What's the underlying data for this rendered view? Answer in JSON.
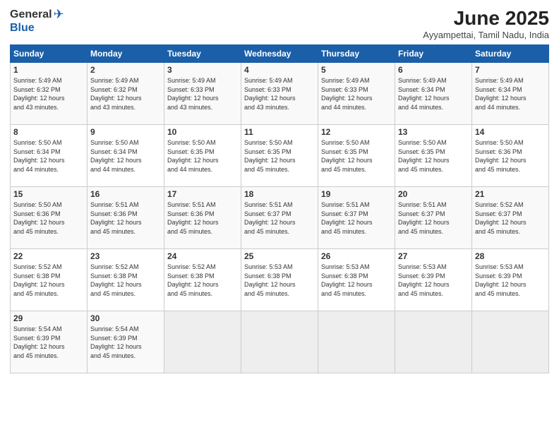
{
  "header": {
    "logo_general": "General",
    "logo_blue": "Blue",
    "title": "June 2025",
    "subtitle": "Ayyampettai, Tamil Nadu, India"
  },
  "days_of_week": [
    "Sunday",
    "Monday",
    "Tuesday",
    "Wednesday",
    "Thursday",
    "Friday",
    "Saturday"
  ],
  "weeks": [
    [
      {
        "num": "1",
        "info": "Sunrise: 5:49 AM\nSunset: 6:32 PM\nDaylight: 12 hours\nand 43 minutes."
      },
      {
        "num": "2",
        "info": "Sunrise: 5:49 AM\nSunset: 6:32 PM\nDaylight: 12 hours\nand 43 minutes."
      },
      {
        "num": "3",
        "info": "Sunrise: 5:49 AM\nSunset: 6:33 PM\nDaylight: 12 hours\nand 43 minutes."
      },
      {
        "num": "4",
        "info": "Sunrise: 5:49 AM\nSunset: 6:33 PM\nDaylight: 12 hours\nand 43 minutes."
      },
      {
        "num": "5",
        "info": "Sunrise: 5:49 AM\nSunset: 6:33 PM\nDaylight: 12 hours\nand 44 minutes."
      },
      {
        "num": "6",
        "info": "Sunrise: 5:49 AM\nSunset: 6:34 PM\nDaylight: 12 hours\nand 44 minutes."
      },
      {
        "num": "7",
        "info": "Sunrise: 5:49 AM\nSunset: 6:34 PM\nDaylight: 12 hours\nand 44 minutes."
      }
    ],
    [
      {
        "num": "8",
        "info": "Sunrise: 5:50 AM\nSunset: 6:34 PM\nDaylight: 12 hours\nand 44 minutes."
      },
      {
        "num": "9",
        "info": "Sunrise: 5:50 AM\nSunset: 6:34 PM\nDaylight: 12 hours\nand 44 minutes."
      },
      {
        "num": "10",
        "info": "Sunrise: 5:50 AM\nSunset: 6:35 PM\nDaylight: 12 hours\nand 44 minutes."
      },
      {
        "num": "11",
        "info": "Sunrise: 5:50 AM\nSunset: 6:35 PM\nDaylight: 12 hours\nand 45 minutes."
      },
      {
        "num": "12",
        "info": "Sunrise: 5:50 AM\nSunset: 6:35 PM\nDaylight: 12 hours\nand 45 minutes."
      },
      {
        "num": "13",
        "info": "Sunrise: 5:50 AM\nSunset: 6:35 PM\nDaylight: 12 hours\nand 45 minutes."
      },
      {
        "num": "14",
        "info": "Sunrise: 5:50 AM\nSunset: 6:36 PM\nDaylight: 12 hours\nand 45 minutes."
      }
    ],
    [
      {
        "num": "15",
        "info": "Sunrise: 5:50 AM\nSunset: 6:36 PM\nDaylight: 12 hours\nand 45 minutes."
      },
      {
        "num": "16",
        "info": "Sunrise: 5:51 AM\nSunset: 6:36 PM\nDaylight: 12 hours\nand 45 minutes."
      },
      {
        "num": "17",
        "info": "Sunrise: 5:51 AM\nSunset: 6:36 PM\nDaylight: 12 hours\nand 45 minutes."
      },
      {
        "num": "18",
        "info": "Sunrise: 5:51 AM\nSunset: 6:37 PM\nDaylight: 12 hours\nand 45 minutes."
      },
      {
        "num": "19",
        "info": "Sunrise: 5:51 AM\nSunset: 6:37 PM\nDaylight: 12 hours\nand 45 minutes."
      },
      {
        "num": "20",
        "info": "Sunrise: 5:51 AM\nSunset: 6:37 PM\nDaylight: 12 hours\nand 45 minutes."
      },
      {
        "num": "21",
        "info": "Sunrise: 5:52 AM\nSunset: 6:37 PM\nDaylight: 12 hours\nand 45 minutes."
      }
    ],
    [
      {
        "num": "22",
        "info": "Sunrise: 5:52 AM\nSunset: 6:38 PM\nDaylight: 12 hours\nand 45 minutes."
      },
      {
        "num": "23",
        "info": "Sunrise: 5:52 AM\nSunset: 6:38 PM\nDaylight: 12 hours\nand 45 minutes."
      },
      {
        "num": "24",
        "info": "Sunrise: 5:52 AM\nSunset: 6:38 PM\nDaylight: 12 hours\nand 45 minutes."
      },
      {
        "num": "25",
        "info": "Sunrise: 5:53 AM\nSunset: 6:38 PM\nDaylight: 12 hours\nand 45 minutes."
      },
      {
        "num": "26",
        "info": "Sunrise: 5:53 AM\nSunset: 6:38 PM\nDaylight: 12 hours\nand 45 minutes."
      },
      {
        "num": "27",
        "info": "Sunrise: 5:53 AM\nSunset: 6:39 PM\nDaylight: 12 hours\nand 45 minutes."
      },
      {
        "num": "28",
        "info": "Sunrise: 5:53 AM\nSunset: 6:39 PM\nDaylight: 12 hours\nand 45 minutes."
      }
    ],
    [
      {
        "num": "29",
        "info": "Sunrise: 5:54 AM\nSunset: 6:39 PM\nDaylight: 12 hours\nand 45 minutes."
      },
      {
        "num": "30",
        "info": "Sunrise: 5:54 AM\nSunset: 6:39 PM\nDaylight: 12 hours\nand 45 minutes."
      },
      {
        "num": "",
        "info": ""
      },
      {
        "num": "",
        "info": ""
      },
      {
        "num": "",
        "info": ""
      },
      {
        "num": "",
        "info": ""
      },
      {
        "num": "",
        "info": ""
      }
    ]
  ]
}
